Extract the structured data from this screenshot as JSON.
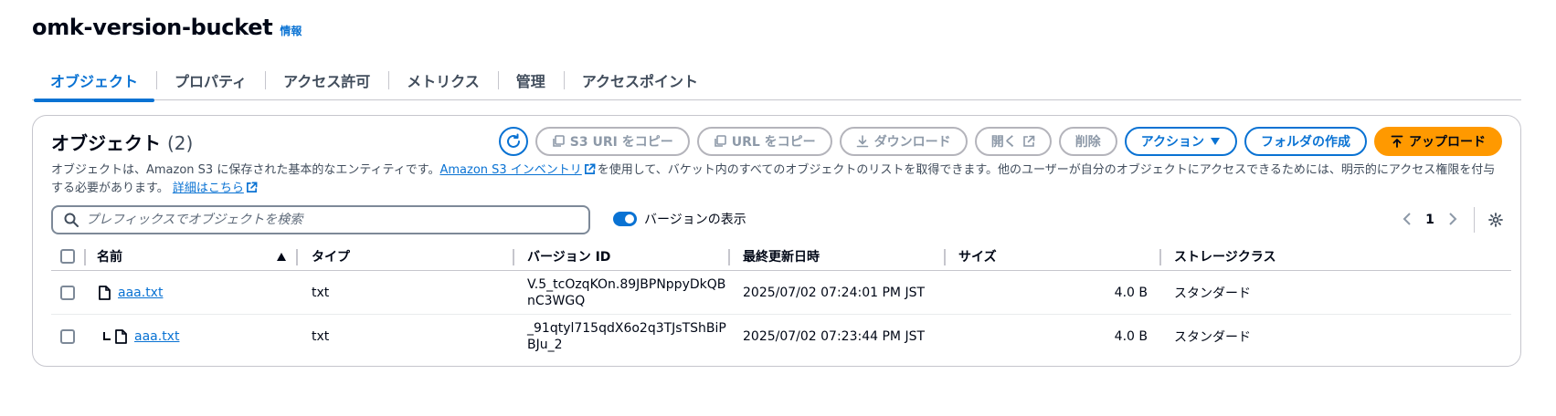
{
  "bucket": {
    "name": "omk-version-bucket",
    "info": "情報"
  },
  "tabs": [
    {
      "label": "オブジェクト",
      "active": true
    },
    {
      "label": "プロパティ"
    },
    {
      "label": "アクセス許可"
    },
    {
      "label": "メトリクス"
    },
    {
      "label": "管理"
    },
    {
      "label": "アクセスポイント"
    }
  ],
  "objects": {
    "title": "オブジェクト",
    "count": "(2)",
    "toolbar": {
      "copy_s3_uri": "S3 URI をコピー",
      "copy_url": "URL をコピー",
      "download": "ダウンロード",
      "open": "開く",
      "delete": "削除",
      "actions": "アクション",
      "create_folder": "フォルダの作成",
      "upload": "アップロード"
    },
    "description": {
      "part1": "オブジェクトは、Amazon S3 に保存された基本的なエンティティです。",
      "inventory_link": "Amazon S3 インベントリ",
      "part2": "を使用して、バケット内のすべてのオブジェクトのリストを取得できます。他のユーザーが自分のオブジェクトにアクセスできるためには、明示的にアクセス権限を付与する必要があります。",
      "learn_more": "詳細はこちら"
    },
    "search": {
      "placeholder": "プレフィックスでオブジェクトを検索"
    },
    "show_versions": {
      "label": "バージョンの表示",
      "on": true
    },
    "pagination": {
      "current": "1"
    },
    "columns": {
      "name": "名前",
      "type": "タイプ",
      "version_id": "バージョン ID",
      "last_modified": "最終更新日時",
      "size": "サイズ",
      "storage_class": "ストレージクラス"
    },
    "rows": [
      {
        "name": "aaa.txt",
        "type": "txt",
        "version_id": "V.5_tcOzqKOn.89JBPNppyDkQBnC3WGQ",
        "last_modified": "2025/07/02 07:24:01 PM JST",
        "size": "4.0 B",
        "storage_class": "スタンダード"
      },
      {
        "name": "aaa.txt",
        "type": "txt",
        "version_id": "_91qtyl715qdX6o2q3TJsTShBiPBJu_2",
        "last_modified": "2025/07/02 07:23:44 PM JST",
        "size": "4.0 B",
        "storage_class": "スタンダード"
      }
    ]
  },
  "colors": {
    "link": "#0972d3",
    "primary": "#ff9900",
    "disabled": "#8d99a8",
    "border": "#c6c6cd"
  }
}
